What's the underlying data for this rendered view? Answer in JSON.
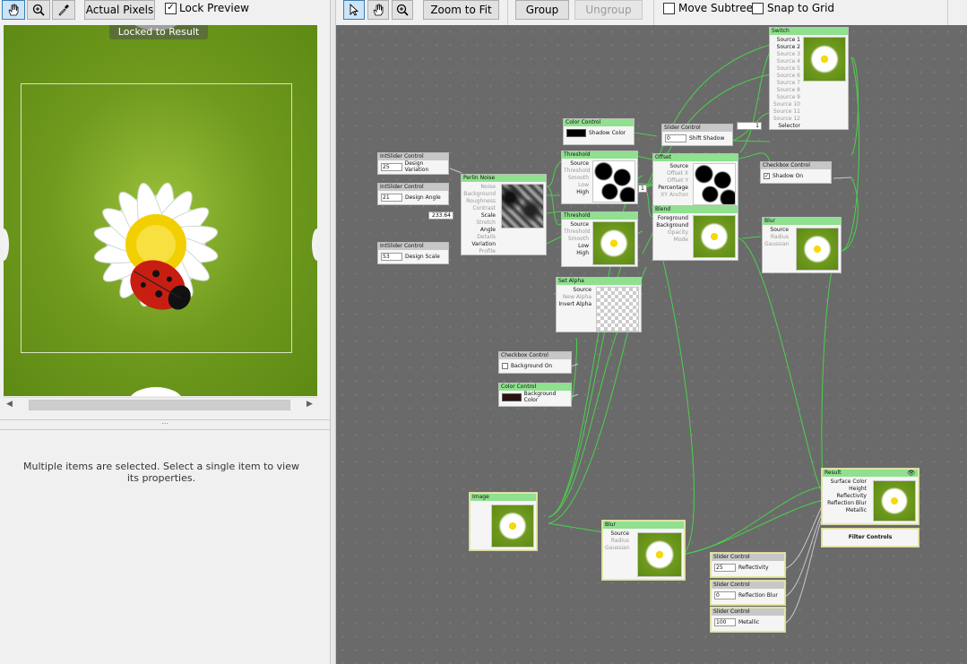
{
  "left_toolbar": {
    "actual_pixels": "Actual Pixels",
    "lock_preview": "Lock Preview",
    "lock_checked": "✓"
  },
  "preview": {
    "locked_label": "Locked to Result"
  },
  "properties": {
    "message": "Multiple items are selected. Select a single item to view its properties."
  },
  "right_toolbar": {
    "zoom_to_fit": "Zoom to Fit",
    "group": "Group",
    "ungroup": "Ungroup",
    "move_subtree": "Move Subtree",
    "snap_to_grid": "Snap to Grid"
  },
  "colors": {
    "node_header": "#8fe08f",
    "control_header": "#c7c7c7",
    "wire": "#4bd14b",
    "canvas": "#6a6a6a"
  },
  "nodes": {
    "switch": {
      "title": "Switch",
      "ports": [
        "Source 1",
        "Source 2",
        "Source 3",
        "Source 4",
        "Source 5",
        "Source 6",
        "Source 7",
        "Source 8",
        "Source 9",
        "Source 10",
        "Source 11",
        "Source 12",
        "Selector"
      ],
      "badge": "1"
    },
    "color_shadow": {
      "title": "Color Control",
      "label": "Shadow Color"
    },
    "slider_shift": {
      "title": "Slider Control",
      "value": "0",
      "label": "Shift Shadow"
    },
    "int_variation": {
      "title": "IntSlider Control",
      "value": "25",
      "label": "Design Variation"
    },
    "int_angle": {
      "title": "IntSlider Control",
      "value": "21",
      "label": "Design Angle"
    },
    "int_scale": {
      "title": "IntSlider Control",
      "value": "53",
      "label": "Design Scale"
    },
    "perlin": {
      "title": "Perlin Noise",
      "ports": [
        "Noise",
        "Background",
        "Roughness",
        "Contrast",
        "Scale",
        "Stretch",
        "Angle",
        "Details",
        "Variation",
        "Profile"
      ],
      "badge": "233.64"
    },
    "threshold1": {
      "title": "Threshold",
      "ports": [
        "Source",
        "Threshold",
        "Smooth",
        "Low",
        "High"
      ]
    },
    "threshold2": {
      "title": "Threshold",
      "ports": [
        "Source",
        "Threshold",
        "Smooth",
        "Low",
        "High"
      ]
    },
    "offset": {
      "title": "Offset",
      "ports": [
        "Source",
        "Offset X",
        "Offset Y",
        "Percentage",
        "XY Anchor"
      ],
      "badge": "1"
    },
    "blend": {
      "title": "Blend",
      "ports": [
        "Foreground",
        "Background",
        "Opacity",
        "Mode"
      ]
    },
    "checkbox_shadow": {
      "title": "Checkbox Control",
      "label": "Shadow On",
      "checked": "✓"
    },
    "blur1": {
      "title": "Blur",
      "ports": [
        "Source",
        "Radius",
        "Gaussian"
      ]
    },
    "set_alpha": {
      "title": "Set Alpha",
      "ports": [
        "Source",
        "New Alpha",
        "Invert Alpha"
      ]
    },
    "checkbox_bg": {
      "title": "Checkbox Control",
      "label": "Background On"
    },
    "color_bg": {
      "title": "Color Control",
      "label": "Background Color"
    },
    "image": {
      "title": "Image"
    },
    "blur2": {
      "title": "Blur",
      "ports": [
        "Source",
        "Radius",
        "Gaussian"
      ]
    },
    "result": {
      "title": "Result",
      "ports": [
        "Surface Color",
        "Height",
        "Reflectivity",
        "Reflection Blur",
        "Metallic"
      ],
      "filter_controls": "Filter Controls"
    },
    "slider_reflectivity": {
      "title": "Slider Control",
      "value": "25",
      "label": "Reflectivity"
    },
    "slider_refblur": {
      "title": "Slider Control",
      "value": "0",
      "label": "Reflection Blur"
    },
    "slider_metallic": {
      "title": "Slider Control",
      "value": "100",
      "label": "Metallic"
    }
  }
}
